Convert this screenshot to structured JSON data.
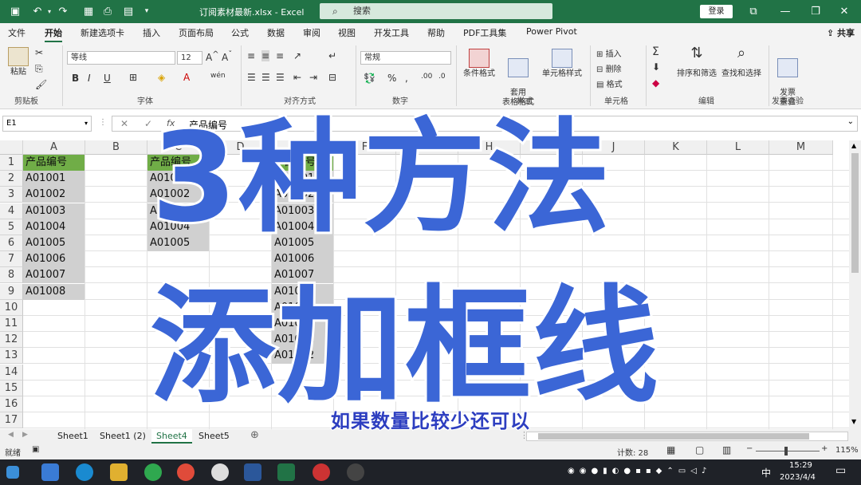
{
  "titlebar": {
    "title": "订阅素材最新.xlsx  -  Excel",
    "search_placeholder": "搜索",
    "login": "登录",
    "bg": "#217346"
  },
  "menu": {
    "items": [
      "文件",
      "开始",
      "新建选项卡",
      "插入",
      "页面布局",
      "公式",
      "数据",
      "审阅",
      "视图",
      "开发工具",
      "帮助",
      "PDF工具集",
      "Power Pivot"
    ],
    "active": "开始",
    "share": "共享"
  },
  "ribbon": {
    "clipboard": {
      "paste": "粘贴",
      "group": "剪贴板"
    },
    "font": {
      "name": "等线",
      "size": "12",
      "group": "字体",
      "bold": "B",
      "italic": "I",
      "underline": "U"
    },
    "align": {
      "group": "对齐方式"
    },
    "number": {
      "format": "常规",
      "group": "数字"
    },
    "styles": {
      "cond": "条件格式",
      "table": "套用\n表格格式",
      "cell": "单元格样式",
      "group": "样式"
    },
    "cells": {
      "insert": "插入",
      "delete": "删除",
      "format": "格式",
      "group": "单元格"
    },
    "edit": {
      "sort": "排序和筛选",
      "find": "查找和选择",
      "group": "编辑"
    },
    "invoice": {
      "check": "发票\n查验",
      "group": "发票查验"
    }
  },
  "formula": {
    "namebox": "E1",
    "fx": "fx",
    "content": "产品编号"
  },
  "columns": [
    "A",
    "B",
    "C",
    "D",
    "E",
    "F",
    "G",
    "H",
    "I",
    "J",
    "K",
    "L",
    "M"
  ],
  "rows": [
    "1",
    "2",
    "3",
    "4",
    "5",
    "6",
    "7",
    "8",
    "9",
    "10",
    "11",
    "12",
    "13",
    "14",
    "15",
    "16",
    "17"
  ],
  "colA": [
    "产品编号",
    "A01001",
    "A01002",
    "A01003",
    "A01004",
    "A01005",
    "A01006",
    "A01007",
    "A01008"
  ],
  "colC": [
    "产品编号",
    "A01001",
    "A01002",
    "A01003",
    "A01004",
    "A01005"
  ],
  "colE": [
    "产品编号",
    "A01001",
    "A01002",
    "A01003",
    "A01004",
    "A01005",
    "A01006",
    "A01007",
    "A01008",
    "A01009",
    "A01010",
    "A01011",
    "A01012"
  ],
  "sheets": [
    "Sheet1",
    "Sheet1 (2)",
    "Sheet4",
    "Sheet5"
  ],
  "active_sheet": "Sheet4",
  "status": {
    "ready": "就绪",
    "count": "计数: 28",
    "zoom": "115%"
  },
  "clock": {
    "time": "15:29",
    "date": "2023/4/4",
    "ime": "中"
  },
  "overlay": {
    "line1": "3种方法",
    "line2": "添加框线",
    "subtitle": "如果数量比较少还可以"
  },
  "colors": {
    "header_green": "#70ad47",
    "cell_gray": "#d0d0d0",
    "overlay_blue": "#3b66d6"
  }
}
